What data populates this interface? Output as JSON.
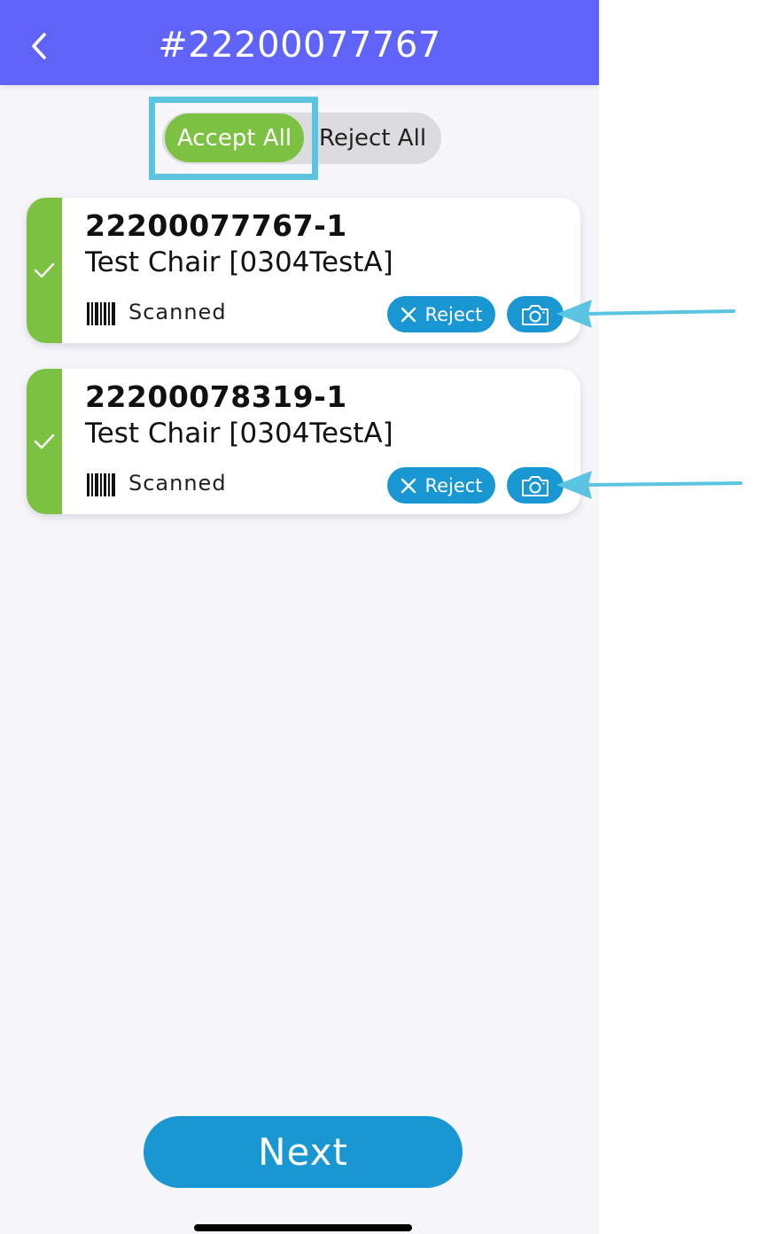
{
  "header": {
    "title": "#22200077767",
    "back_icon": "chevron-left-icon"
  },
  "segmented_control": {
    "accept_label": "Accept All",
    "reject_label": "Reject All",
    "selected": "Accept All"
  },
  "items": [
    {
      "id": "22200077767-1",
      "name": "Test Chair [0304TestA]",
      "status": "Scanned",
      "reject_label": "Reject",
      "check_icon": "checkmark-icon",
      "barcode_icon": "barcode-icon",
      "reject_icon": "close-icon",
      "camera_icon": "camera-icon"
    },
    {
      "id": "22200078319-1",
      "name": "Test Chair [0304TestA]",
      "status": "Scanned",
      "reject_label": "Reject",
      "check_icon": "checkmark-icon",
      "barcode_icon": "barcode-icon",
      "reject_icon": "close-icon",
      "camera_icon": "camera-icon"
    }
  ],
  "footer": {
    "next_label": "Next"
  },
  "colors": {
    "header": "#6063f7",
    "accept_green": "#7cc142",
    "action_blue": "#1897d3",
    "highlight": "#5bc4e0"
  }
}
